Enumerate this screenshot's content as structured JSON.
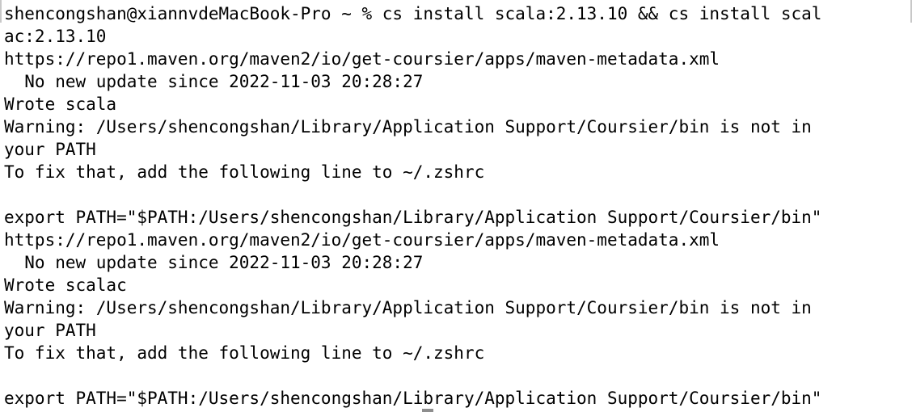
{
  "terminal": {
    "lines": [
      "shencongshan@xiannvdeMacBook-Pro ~ % cs install scala:2.13.10 && cs install scal",
      "ac:2.13.10",
      "https://repo1.maven.org/maven2/io/get-coursier/apps/maven-metadata.xml",
      "  No new update since 2022-11-03 20:28:27",
      "Wrote scala",
      "Warning: /Users/shencongshan/Library/Application Support/Coursier/bin is not in",
      "your PATH",
      "To fix that, add the following line to ~/.zshrc",
      "",
      "export PATH=\"$PATH:/Users/shencongshan/Library/Application Support/Coursier/bin\"",
      "https://repo1.maven.org/maven2/io/get-coursier/apps/maven-metadata.xml",
      "  No new update since 2022-11-03 20:28:27",
      "Wrote scalac",
      "Warning: /Users/shencongshan/Library/Application Support/Coursier/bin is not in",
      "your PATH",
      "To fix that, add the following line to ~/.zshrc",
      "",
      "export PATH=\"$PATH:/Users/shencongshan/Library/Application Support/Coursier/bin\""
    ]
  }
}
